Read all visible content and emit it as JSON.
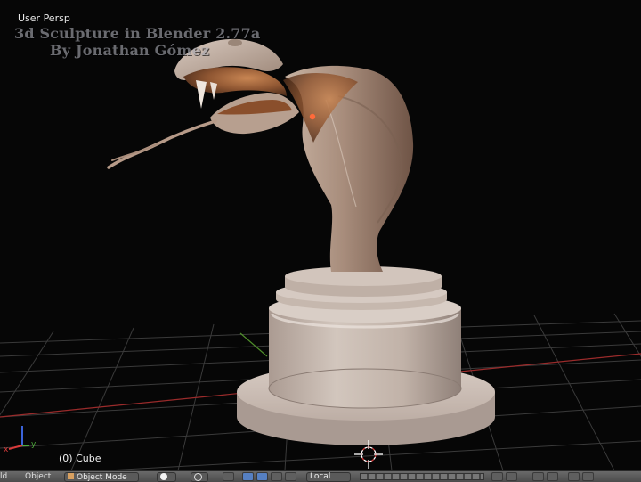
{
  "viewport": {
    "view_label": "User Persp",
    "watermark_line1": "3d Sculpture in Blender 2.77a",
    "watermark_line2": "By Jonathan Gómez",
    "object_label": "(0) Cube",
    "axis_x_label": "x",
    "axis_y_label": "y"
  },
  "header": {
    "menu_left_label": "ld",
    "object_menu_label": "Object",
    "mode_label": "Object Mode",
    "orientation_label": "Local"
  },
  "colors": {
    "background": "#060606",
    "grid_line": "#3a3a3a",
    "axis_x": "#9a2b2b",
    "axis_y": "#4f8f2a",
    "header_bg": "#5a5a5a",
    "active_button": "#5680c2",
    "sculpture_clay": "#b8a89c"
  },
  "icons": [
    "view-type-icon",
    "object-mode-icon",
    "shading-sphere-icon",
    "pivot-icon",
    "manipulator-icon",
    "translate-icon",
    "rotate-icon",
    "scale-icon",
    "layers-icon",
    "lock-icon",
    "snap-icon",
    "render-icon",
    "gamepad-icon"
  ]
}
